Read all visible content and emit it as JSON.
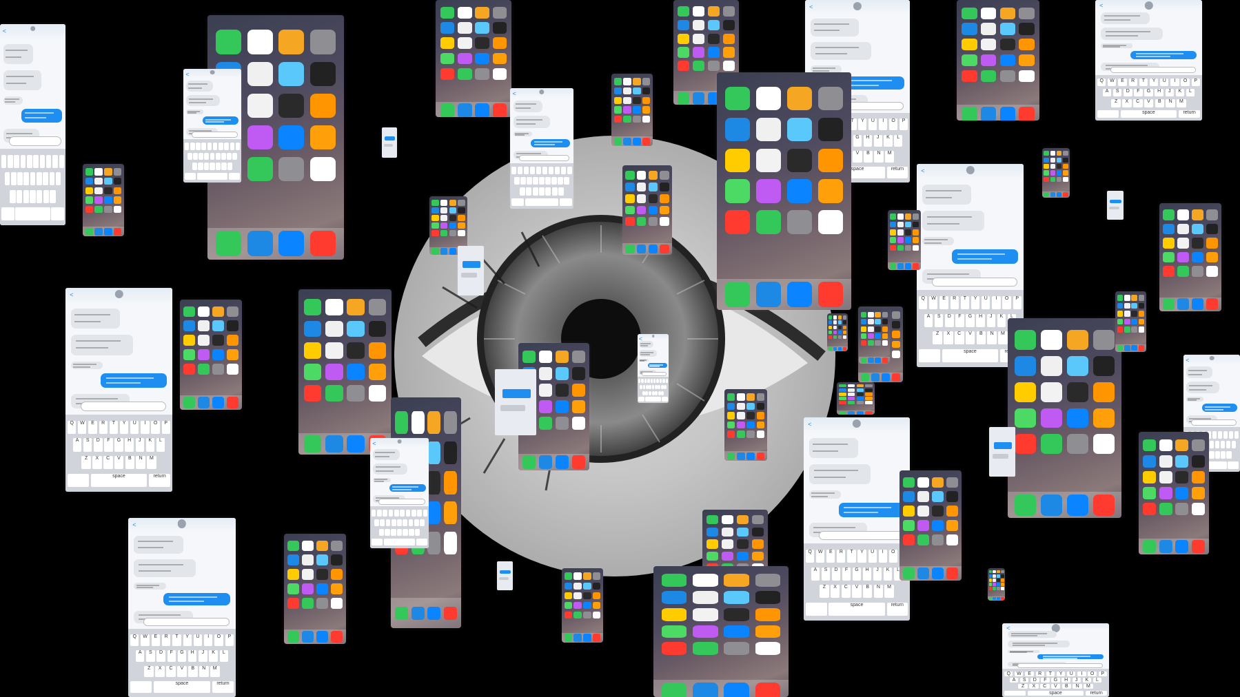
{
  "scene": {
    "description_colors": {
      "background": "#000000",
      "eye_iris": "#6b6b6b",
      "message_blue": "#1e8ef0"
    }
  },
  "messages": {
    "back_label": "<",
    "keyboard_row1": [
      "Q",
      "W",
      "E",
      "R",
      "T",
      "Y",
      "U",
      "I",
      "O",
      "P"
    ],
    "keyboard_row2": [
      "A",
      "S",
      "D",
      "F",
      "G",
      "H",
      "J",
      "K",
      "L"
    ],
    "keyboard_row3": [
      "Z",
      "X",
      "C",
      "V",
      "B",
      "N",
      "M"
    ],
    "space_label": "space",
    "return_label": "return"
  },
  "home": {
    "app_colors": [
      "#34c759",
      "#ffffff",
      "#f5a623",
      "#8e8e93",
      "#1e88e5",
      "#f0f0f0",
      "#5ac8fa",
      "#222222",
      "#ffcc00",
      "#f2f2f2",
      "#2a2a2a",
      "#ff9500",
      "#4cd964",
      "#bf5af2",
      "#0a84ff",
      "#ff9f0a",
      "#ff3b30",
      "#34c759",
      "#8e8e93",
      "#ffffff"
    ],
    "dock_colors": [
      "#34c759",
      "#1e88e5",
      "#0a84ff",
      "#ff3b30"
    ]
  }
}
